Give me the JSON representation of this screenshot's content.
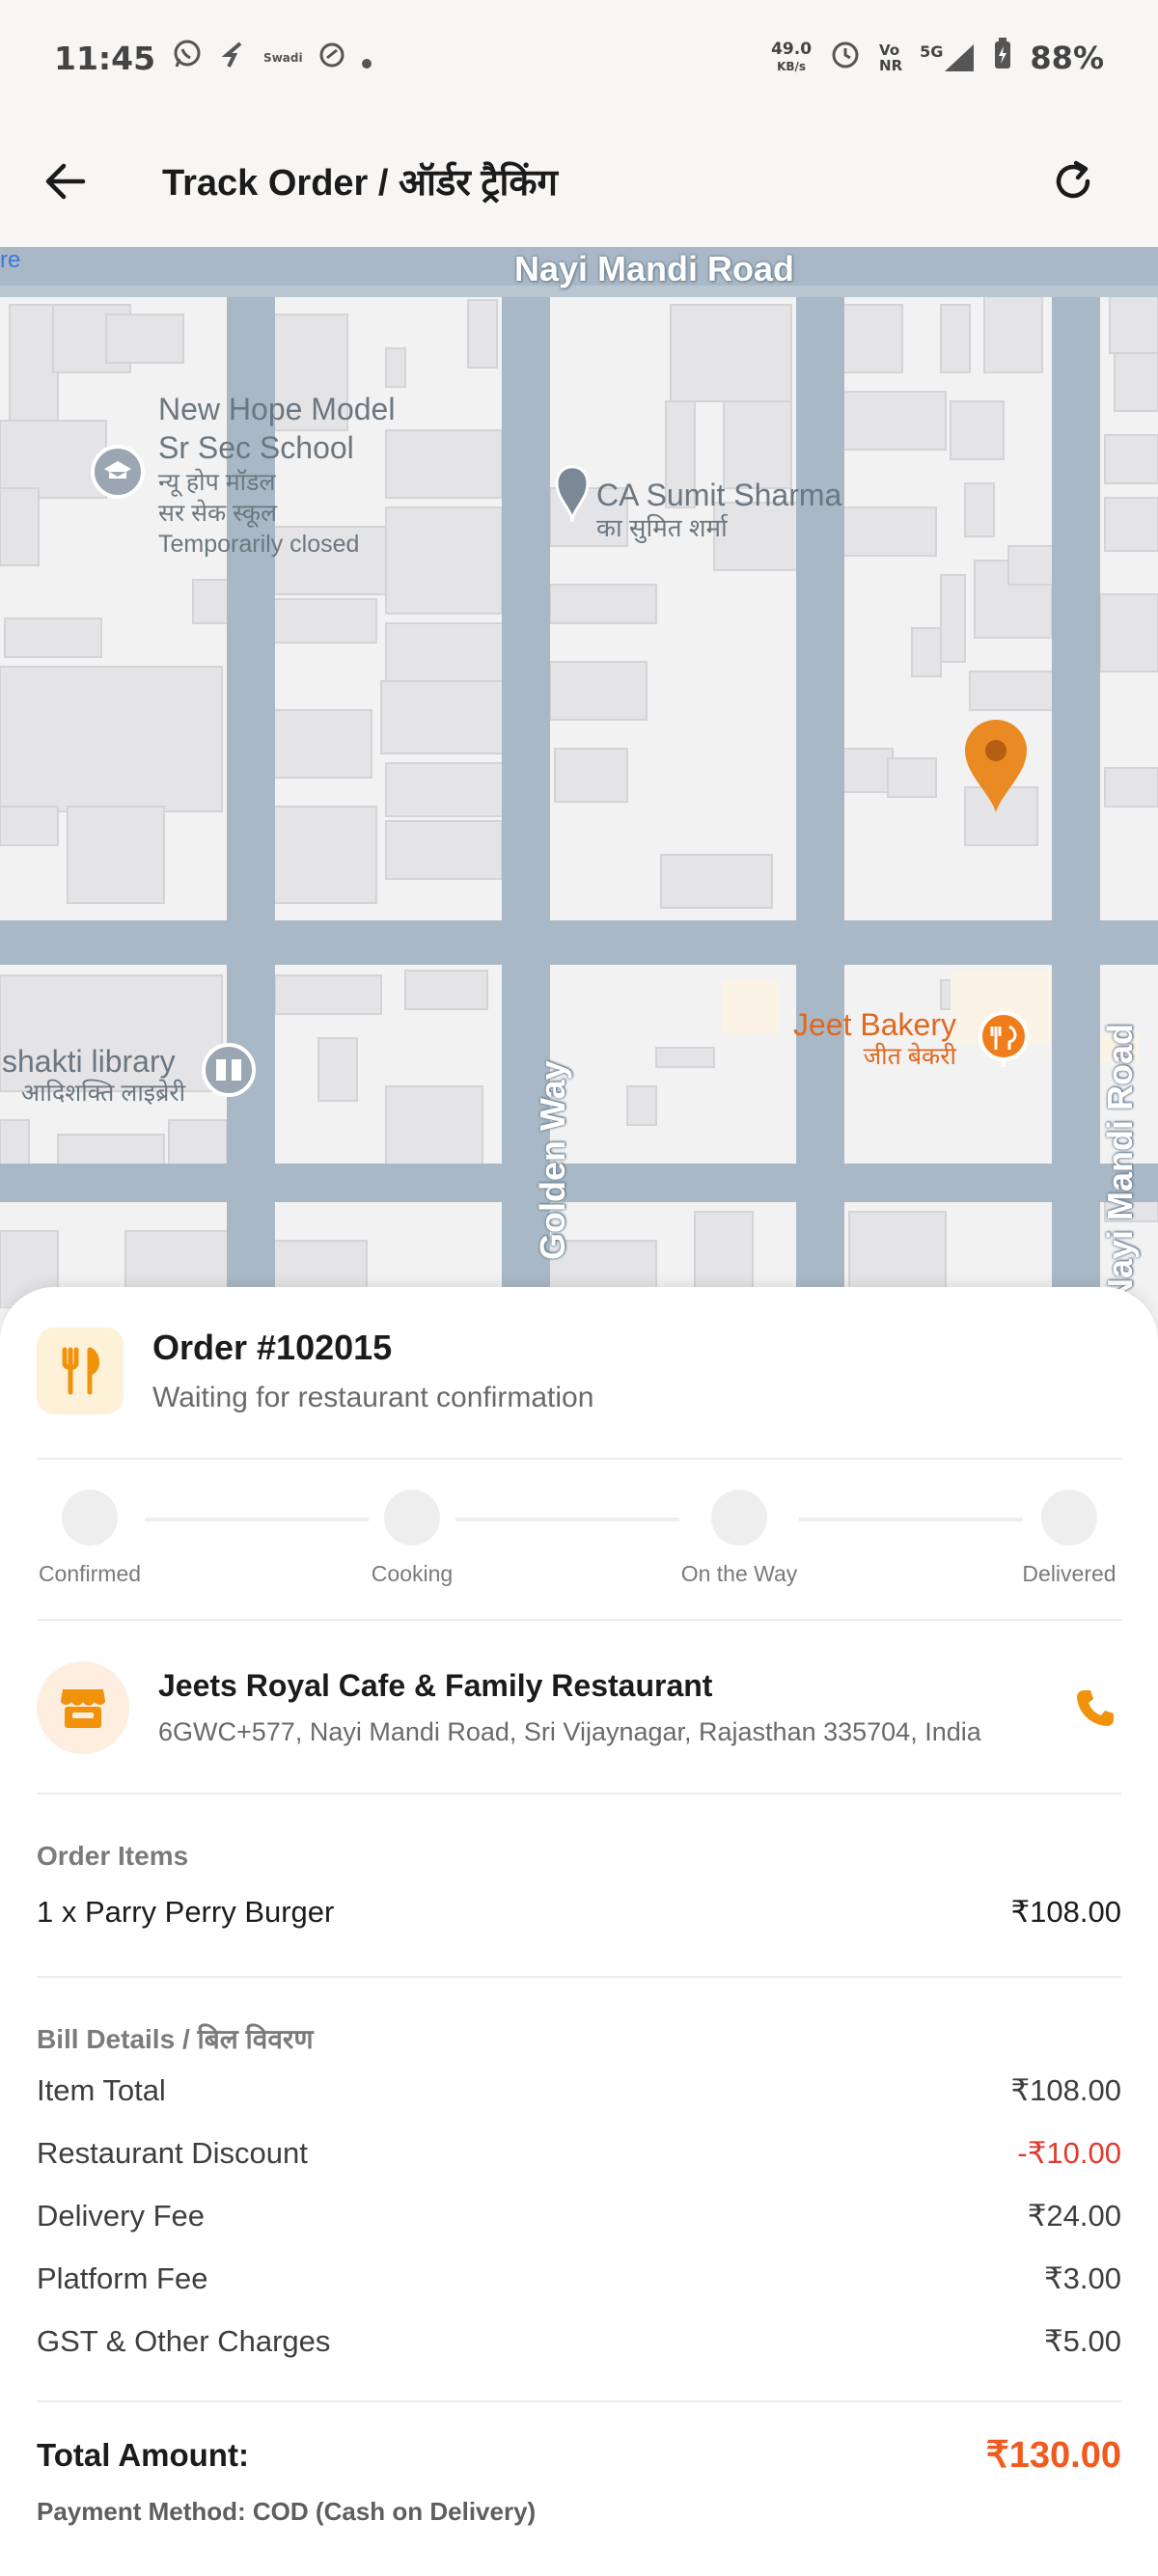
{
  "status_bar": {
    "time": "11:45",
    "speed_value": "49.0",
    "speed_unit": "KB/s",
    "net_top": "Vo",
    "net_bottom": "NR",
    "net_5g": "5G",
    "battery": "88%",
    "tiny_app": "Swadi"
  },
  "app_bar": {
    "title": "Track Order / ऑर्डर ट्रैकिंग"
  },
  "map": {
    "roads": {
      "top": "Nayi Mandi Road",
      "vertical_left": "Golden Way",
      "vertical_right": "Nayi Mandi Road"
    },
    "pois": {
      "school_line1": "New Hope Model",
      "school_line2": "Sr Sec School",
      "school_hi1": "न्यू होप मॉडल",
      "school_hi2": "सर सेक स्कूल",
      "school_status": "Temporarily closed",
      "ca_name": "CA Sumit Sharma",
      "ca_hi": "का सुमित शर्मा",
      "library_name": "shakti library",
      "library_hi": "आदिशक्ति लाइब्रेरी",
      "bakery_name": "Jeet Bakery",
      "bakery_hi": "जीत बेकरी",
      "edge_fragment": "re"
    },
    "accent_pin_color": "#e98a22"
  },
  "order": {
    "number": "Order #102015",
    "status": "Waiting for restaurant confirmation"
  },
  "progress": {
    "steps": [
      "Confirmed",
      "Cooking",
      "On the Way",
      "Delivered"
    ]
  },
  "restaurant": {
    "name": "Jeets Royal Cafe & Family Restaurant",
    "address": "6GWC+577, Nayi Mandi Road, Sri Vijaynagar, Rajasthan 335704, India"
  },
  "items": {
    "title": "Order Items",
    "list": [
      {
        "name": "1 x Parry Perry Burger",
        "price": "₹108.00"
      }
    ]
  },
  "bill": {
    "title": "Bill Details / बिल विवरण",
    "rows": [
      {
        "label": "Item Total",
        "value": "₹108.00"
      },
      {
        "label": "Restaurant Discount",
        "value": "-₹10.00"
      },
      {
        "label": "Delivery Fee",
        "value": "₹24.00"
      },
      {
        "label": "Platform Fee",
        "value": "₹3.00"
      },
      {
        "label": "GST & Other Charges",
        "value": "₹5.00"
      }
    ],
    "total_label": "Total Amount:",
    "total_value": "₹130.00",
    "payment": "Payment Method: COD (Cash on Delivery)"
  },
  "colors": {
    "accent_orange": "#f05a1f",
    "discount_red": "#e23b2e",
    "icon_orange": "#f0920a"
  }
}
